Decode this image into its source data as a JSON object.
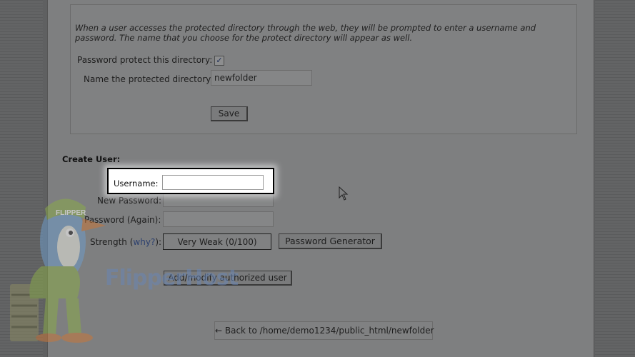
{
  "intro_text": "When a user accesses the protected directory through the web, they will be prompted to enter a username and password. The name that you choose for the protect directory will appear as well.",
  "protect": {
    "checkbox_label": "Password protect this directory:",
    "checked": true,
    "name_label": "Name the protected directory:",
    "name_value": "newfolder",
    "save_label": "Save"
  },
  "create_user": {
    "title": "Create User:",
    "username_label": "Username:",
    "username_value": "",
    "new_password_label": "New Password:",
    "password_again_label": "Password (Again):",
    "strength_label": "Strength",
    "why_link": "why?",
    "strength_value": "Very Weak (0/100)",
    "generator_label": "Password Generator",
    "submit_label": "Add/modify authorized user"
  },
  "back_link": "← Back to /home/demo1234/public_html/newfolder",
  "watermark": "FlipperHost",
  "mascot_cap_text": "FLIPPER HOST",
  "colors": {
    "highlight_border": "#000000",
    "highlight_bg": "#ffffff",
    "link": "#2b3f6e"
  }
}
